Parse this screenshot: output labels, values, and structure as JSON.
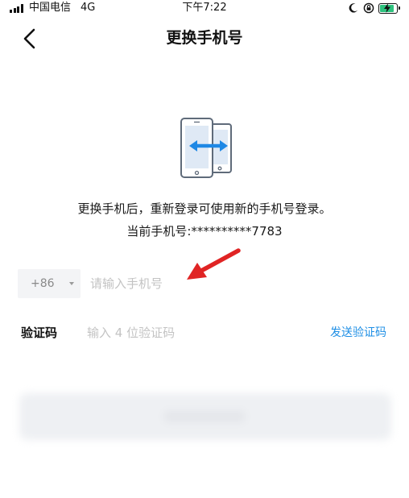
{
  "status_bar": {
    "carrier": "中国电信",
    "network": "4G",
    "time": "下午7:22",
    "battery_charging": true
  },
  "nav": {
    "title": "更换手机号"
  },
  "info": {
    "line1": "更换手机后，重新登录可使用新的手机号登录。",
    "line2": "当前手机号:**********7783"
  },
  "phone_form": {
    "country_code": "+86",
    "phone_placeholder": "请输入手机号"
  },
  "code_form": {
    "label": "验证码",
    "code_placeholder": "输入 4 位验证码",
    "send_label": "发送验证码"
  },
  "colors": {
    "link": "#1f8fe5",
    "illustration_arrow": "#1e88e5",
    "annotation_arrow": "#e02424",
    "battery": "#2ec27e"
  },
  "icons": {
    "back": "chevron-left-icon",
    "illustration": "phone-swap-icon",
    "annotation": "red-pointer-arrow"
  }
}
